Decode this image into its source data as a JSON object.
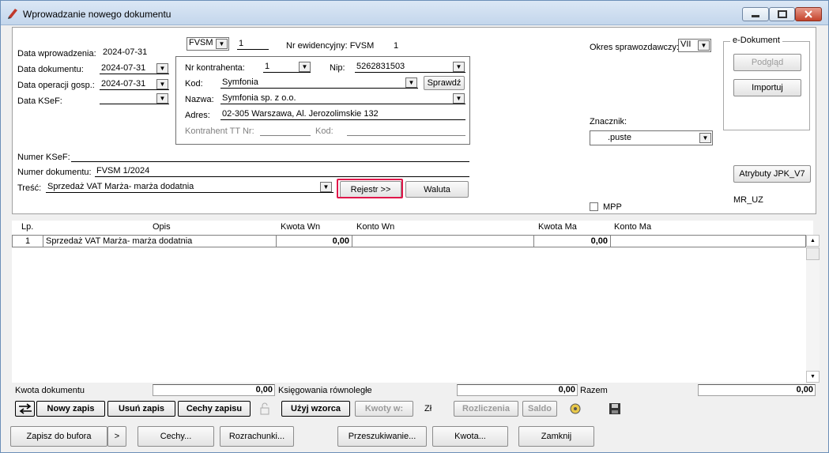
{
  "window": {
    "title": "Wprowadzanie nowego dokumentu"
  },
  "form": {
    "data_wprowadzenia_label": "Data wprowadzenia:",
    "data_wprowadzenia": "2024-07-31",
    "data_dokumentu_label": "Data dokumentu:",
    "data_dokumentu": "2024-07-31",
    "data_operacji_label": "Data operacji gosp.:",
    "data_operacji": "2024-07-31",
    "data_ksef_label": "Data KSeF:",
    "typ": "FVSM",
    "typ_nr": "1",
    "nr_ewidencyjny": "Nr ewidencyjny: FVSM",
    "nr_ewidencyjny_val": "1",
    "nr_kontrahenta_label": "Nr kontrahenta:",
    "nr_kontrahenta": "1",
    "nip_label": "Nip:",
    "nip": "5262831503",
    "kod_label": "Kod:",
    "kod": "Symfonia",
    "sprawdz": "Sprawdź",
    "nazwa_label": "Nazwa:",
    "nazwa": "Symfonia sp. z o.o.",
    "adres_label": "Adres:",
    "adres": "02-305 Warszawa, Al. Jerozolimskie 132",
    "kontrahent_tt_label": "Kontrahent TT Nr:",
    "kod2_label": "Kod:",
    "numer_ksef_label": "Numer KSeF:",
    "numer_dok_label": "Numer dokumentu:",
    "numer_dok": "FVSM 1/2024",
    "tresc_label": "Treść:",
    "tresc": "Sprzedaż VAT Marża- marża dodatnia",
    "rejestr": "Rejestr >>",
    "waluta": "Waluta",
    "okres_label": "Okres sprawozdawczy:",
    "okres": "VII",
    "edokument_title": "e-Dokument",
    "podglad": "Podgląd",
    "importuj": "Importuj",
    "znacznik_label": "Znacznik:",
    "znacznik": ".puste",
    "atrybuty": "Atrybuty JPK_V7",
    "mpp": "MPP",
    "mr_uz": "MR_UZ"
  },
  "grid": {
    "headers": {
      "lp": "Lp.",
      "opis": "Opis",
      "kwota_wn": "Kwota Wn",
      "konto_wn": "Konto Wn",
      "kwota_ma": "Kwota Ma",
      "konto_ma": "Konto Ma"
    },
    "rows": [
      {
        "lp": "1",
        "opis": "Sprzedaż VAT Marża- marża dodatnia",
        "kwota_wn": "0,00",
        "konto_wn": "",
        "kwota_ma": "0,00",
        "konto_ma": ""
      }
    ]
  },
  "summary": {
    "kwota_dokumentu_label": "Kwota dokumentu",
    "kwota_dokumentu": "0,00",
    "ksiegowania_label": "Księgowania równoległe",
    "ksiegowania": "0,00",
    "razem_label": "Razem",
    "razem": "0,00"
  },
  "toolbar": {
    "nowy_zapis": "Nowy zapis",
    "usun_zapis": "Usuń zapis",
    "cechy_zapisu": "Cechy zapisu",
    "uzyj_wzorca": "Użyj wzorca",
    "kwoty_w": "Kwoty w:",
    "currency": "Zł",
    "rozliczenia": "Rozliczenia",
    "saldo": "Saldo"
  },
  "bottom": {
    "zapisz": "Zapisz do bufora",
    "more": ">",
    "cechy": "Cechy...",
    "rozrachunki": "Rozrachunki...",
    "przeszukiwanie": "Przeszukiwanie...",
    "kwota": "Kwota...",
    "zamknij": "Zamknij"
  }
}
